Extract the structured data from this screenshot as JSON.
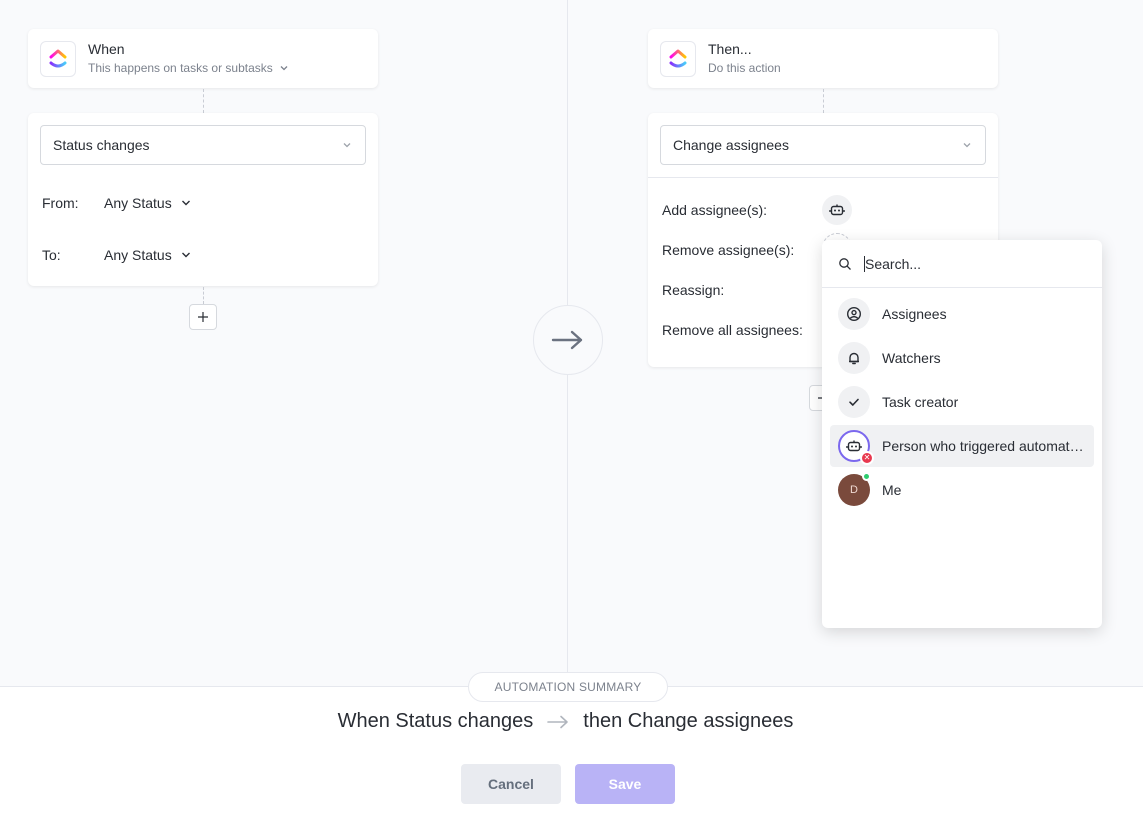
{
  "trigger": {
    "title": "When",
    "subtitle": "This happens on tasks or subtasks",
    "select_value": "Status changes",
    "from_label": "From:",
    "from_value": "Any Status",
    "to_label": "To:",
    "to_value": "Any Status"
  },
  "action": {
    "title": "Then...",
    "subtitle": "Do this action",
    "select_value": "Change assignees",
    "rows": {
      "add": "Add assignee(s):",
      "remove": "Remove assignee(s):",
      "reassign": "Reassign:",
      "remove_all": "Remove all assignees:"
    }
  },
  "dropdown": {
    "search_placeholder": "Search...",
    "items": [
      {
        "label": "Assignees",
        "icon": "user-circle-icon"
      },
      {
        "label": "Watchers",
        "icon": "bell-icon"
      },
      {
        "label": "Task creator",
        "icon": "check-icon"
      },
      {
        "label": "Person who triggered automation",
        "icon": "robot-icon"
      },
      {
        "label": "Me",
        "icon": "avatar",
        "initial": "D"
      }
    ],
    "active_index": 3
  },
  "summary": {
    "pill": "AUTOMATION SUMMARY",
    "when_text": "When Status changes",
    "then_text": "then Change assignees"
  },
  "buttons": {
    "cancel": "Cancel",
    "save": "Save"
  },
  "colors": {
    "accent": "#7b68ee",
    "save_disabled": "#b9b3f6",
    "error_badge": "#e8384f",
    "online": "#2ecd6f"
  }
}
